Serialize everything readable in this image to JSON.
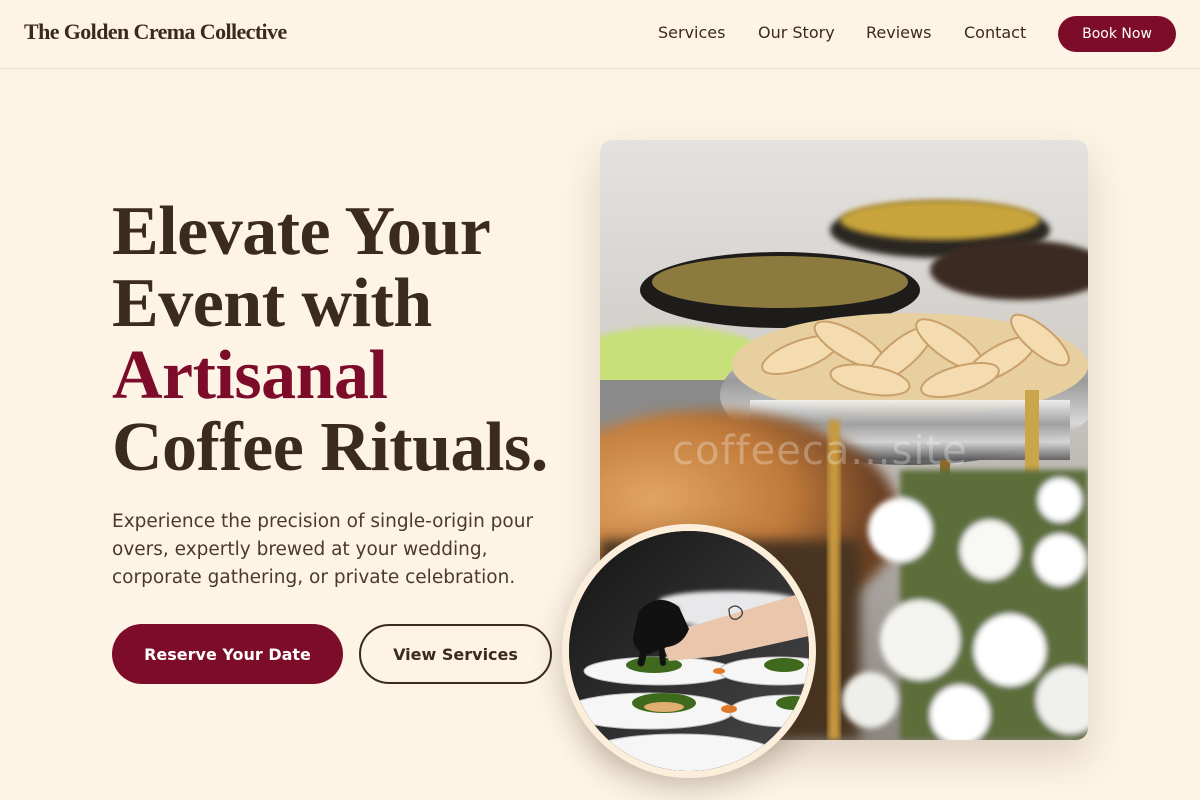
{
  "header": {
    "brand": "The Golden Crema Collective",
    "nav": [
      "Services",
      "Our Story",
      "Reviews",
      "Contact"
    ],
    "cta": "Book Now"
  },
  "hero": {
    "title_line1": "Elevate Your",
    "title_line2": "Event with",
    "title_accent": "Artisanal",
    "title_line4": "Coffee Rituals.",
    "subtitle": "Experience the precision of single-origin pour overs, expertly brewed at your wedding, corporate gathering, or private celebration.",
    "primary_button": "Reserve Your Date",
    "secondary_button": "View Services",
    "watermark": "coffeeca...site"
  },
  "colors": {
    "background": "#fdf4e6",
    "primary": "#7d0c2a",
    "text": "#3b2a1e"
  },
  "images": {
    "hero": "catering-buffet-chafing-dishes-photo",
    "inset": "chef-plating-dishes-photo"
  }
}
